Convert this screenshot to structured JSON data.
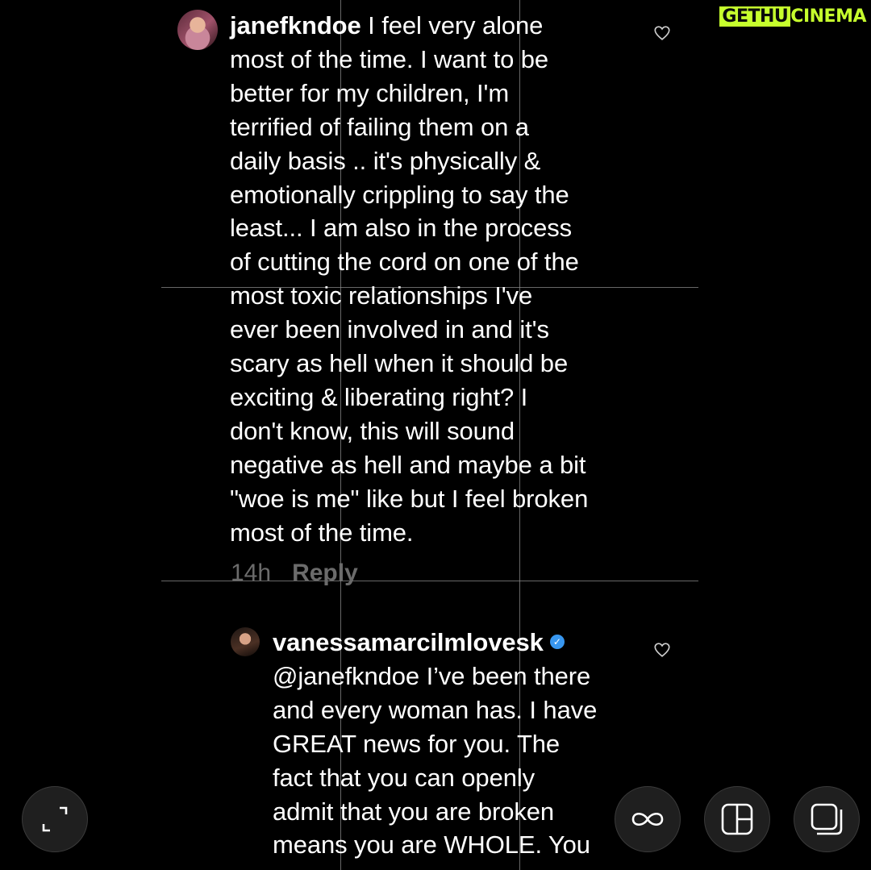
{
  "brand": {
    "left": "GETHU",
    "right": "CINEMA"
  },
  "comment_a": {
    "username": "janefkndoe",
    "text": " I feel very alone\nmost of the time. I want to be\nbetter for my children, I'm\nterrified of failing them on a\ndaily basis .. it's physically &\nemotionally crippling to say the\nleast... I am also in the process\nof cutting the cord on one of the\nmost toxic relationships I've\never been involved in and it's\nscary as hell when it should be\nexciting & liberating right? I\ndon't know, this will sound\nnegative as hell and maybe a bit\n\"woe is me\" like but I feel broken\nmost of the time.",
    "time": "14h",
    "reply": "Reply"
  },
  "comment_b": {
    "username": "vanessamarcilmlovesk",
    "text": "\n@janefkndoe I’ve been there\nand every woman has. I have\nGREAT news for you. The\nfact that you can openly\nadmit that you are broken\nmeans you are WHOLE. You"
  },
  "icons": {
    "like_a": "heart-outline-icon",
    "like_b": "heart-outline-icon",
    "verified": "verified-check-icon",
    "expand": "expand-corners-icon",
    "loop": "infinity-icon",
    "layout": "layout-grid-icon",
    "stack": "stacked-squares-icon"
  },
  "colors": {
    "accent": "#c6ff2d",
    "verified": "#3897f0",
    "meta": "#6b6b6b"
  }
}
